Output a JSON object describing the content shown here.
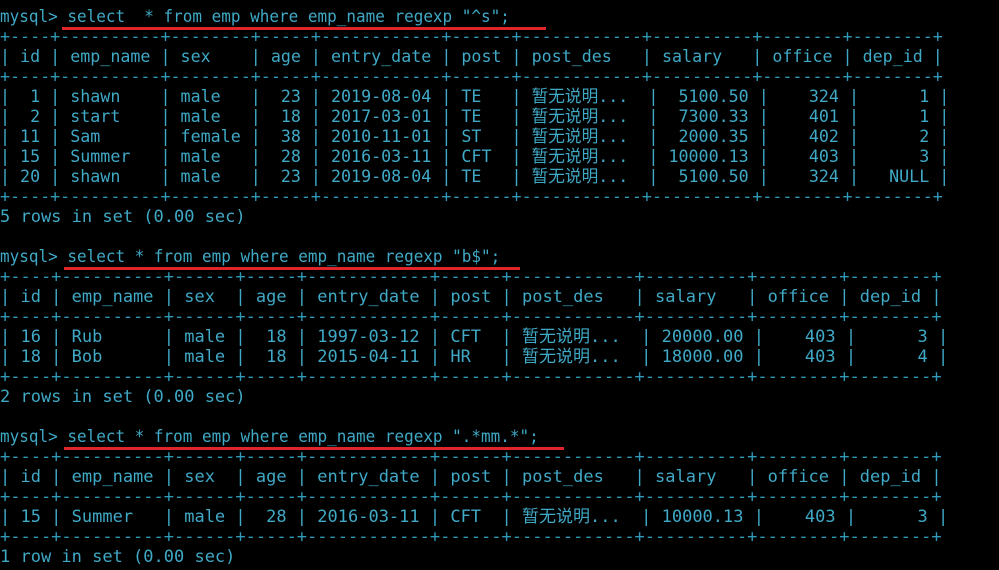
{
  "colors": {
    "background": "#000000",
    "text": "#3fa9c6",
    "highlight_underline": "#e0262b"
  },
  "queries": [
    {
      "command": "mysql> select  * from emp where emp_name regexp \"^s\";",
      "border_top": "+----+----------+--------+-----+------------+------+------------+----------+--------+--------+",
      "header": "| id | emp_name | sex    | age | entry_date | post | post_des   | salary   | office | dep_id |",
      "border_mid": "+----+----------+--------+-----+------------+------+------------+----------+--------+--------+",
      "rows": [
        "|  1 | shawn    | male   |  23 | 2019-08-04 | TE   | 暂无说明...  |  5100.50 |    324 |      1 |",
        "|  2 | start    | male   |  18 | 2017-03-01 | TE   | 暂无说明...  |  7300.33 |    401 |      1 |",
        "| 11 | Sam      | female |  38 | 2010-11-01 | ST   | 暂无说明...  |  2000.35 |    402 |      2 |",
        "| 15 | Summer   | male   |  28 | 2016-03-11 | CFT  | 暂无说明...  | 10000.13 |    403 |      3 |",
        "| 20 | shawn    | male   |  23 | 2019-08-04 | TE   | 暂无说明...  |  5100.50 |    324 |   NULL |"
      ],
      "border_bottom": "+----+----------+--------+-----+------------+------+------------+----------+--------+--------+",
      "summary": "5 rows in set (0.00 sec)"
    },
    {
      "command": "mysql> select * from emp where emp_name regexp \"b$\";",
      "border_top": "+----+----------+------+-----+------------+------+------------+----------+--------+--------+",
      "header": "| id | emp_name | sex  | age | entry_date | post | post_des   | salary   | office | dep_id |",
      "border_mid": "+----+----------+------+-----+------------+------+------------+----------+--------+--------+",
      "rows": [
        "| 16 | Rub      | male |  18 | 1997-03-12 | CFT  | 暂无说明...  | 20000.00 |    403 |      3 |",
        "| 18 | Bob      | male |  18 | 2015-04-11 | HR   | 暂无说明...  | 18000.00 |    403 |      4 |"
      ],
      "border_bottom": "+----+----------+------+-----+------------+------+------------+----------+--------+--------+",
      "summary": "2 rows in set (0.00 sec)"
    },
    {
      "command": "mysql> select * from emp where emp_name regexp \".*mm.*\";",
      "border_top": "+----+----------+------+-----+------------+------+------------+----------+--------+--------+",
      "header": "| id | emp_name | sex  | age | entry_date | post | post_des   | salary   | office | dep_id |",
      "border_mid": "+----+----------+------+-----+------------+------+------------+----------+--------+--------+",
      "rows": [
        "| 15 | Summer   | male |  28 | 2016-03-11 | CFT  | 暂无说明...  | 10000.13 |    403 |      3 |"
      ],
      "border_bottom": "+----+----------+------+-----+------------+------+------------+----------+--------+--------+",
      "summary": "1 row in set (0.00 sec)"
    }
  ]
}
